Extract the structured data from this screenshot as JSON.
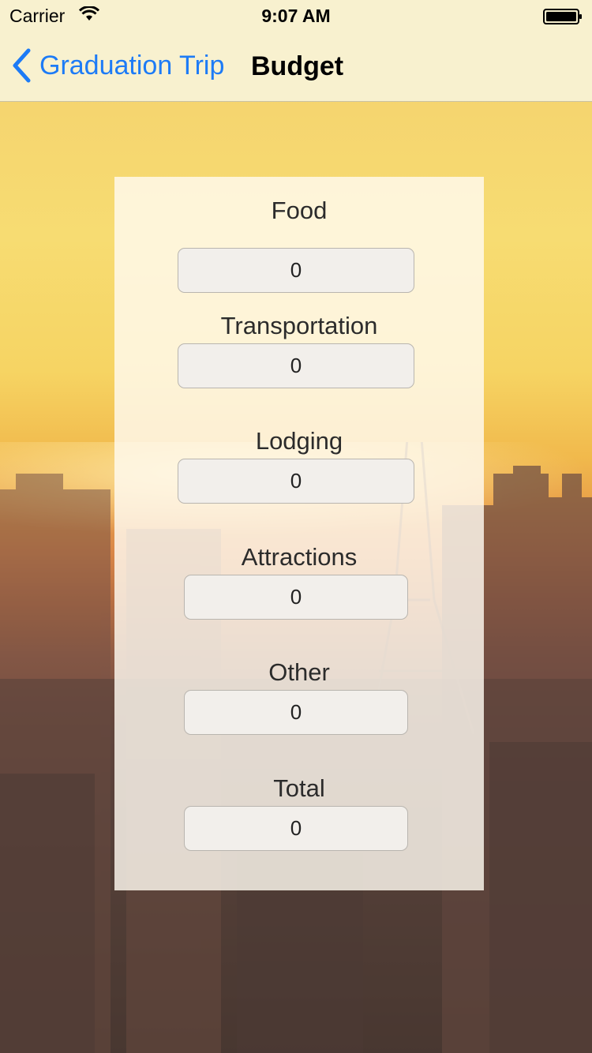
{
  "status_bar": {
    "carrier": "Carrier",
    "time": "9:07 AM"
  },
  "nav_bar": {
    "back_label": "Graduation Trip",
    "title": "Budget"
  },
  "budget": {
    "food": {
      "label": "Food",
      "value": "0"
    },
    "transportation": {
      "label": "Transportation",
      "value": "0"
    },
    "lodging": {
      "label": "Lodging",
      "value": "0"
    },
    "attractions": {
      "label": "Attractions",
      "value": "0"
    },
    "other": {
      "label": "Other",
      "value": "0"
    },
    "total": {
      "label": "Total",
      "value": "0"
    }
  },
  "colors": {
    "accent": "#1d7bf6",
    "bar_background": "#f8f1cf"
  }
}
